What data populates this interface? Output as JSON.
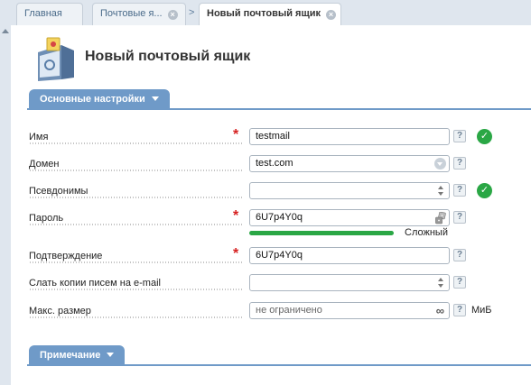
{
  "tabs": [
    {
      "label": "Главная",
      "active": false,
      "closable": false
    },
    {
      "label": "Почтовые я...",
      "active": false,
      "closable": true
    },
    {
      "label": "Новый почтовый ящик",
      "active": true,
      "closable": true
    }
  ],
  "page": {
    "title": "Новый почтовый ящик",
    "icon": "mailbox-icon"
  },
  "sections": {
    "main": {
      "label": "Основные настройки"
    },
    "note": {
      "label": "Примечание"
    }
  },
  "fields": {
    "name": {
      "label": "Имя",
      "required": true,
      "value": "testmail",
      "valid": true
    },
    "domain": {
      "label": "Домен",
      "required": false,
      "value": "test.com"
    },
    "aliases": {
      "label": "Псевдонимы",
      "required": false,
      "value": "",
      "valid": true
    },
    "password": {
      "label": "Пароль",
      "required": true,
      "value": "6U7p4Y0q",
      "strength": "Сложный"
    },
    "confirm": {
      "label": "Подтверждение",
      "required": true,
      "value": "6U7p4Y0q"
    },
    "copies": {
      "label": "Слать копии писем на e-mail",
      "required": false,
      "value": ""
    },
    "max_size": {
      "label": "Макс. размер",
      "required": false,
      "placeholder": "не ограничено",
      "unit": "МиБ"
    }
  },
  "ui": {
    "help_glyph": "?",
    "required_glyph": "*",
    "ok_glyph": "✓",
    "close_glyph": "×",
    "arrow_glyph": ">",
    "infinity_glyph": "∞"
  },
  "colors": {
    "accent": "#6f9ac8",
    "ok": "#2aa745",
    "required": "#d62020"
  }
}
